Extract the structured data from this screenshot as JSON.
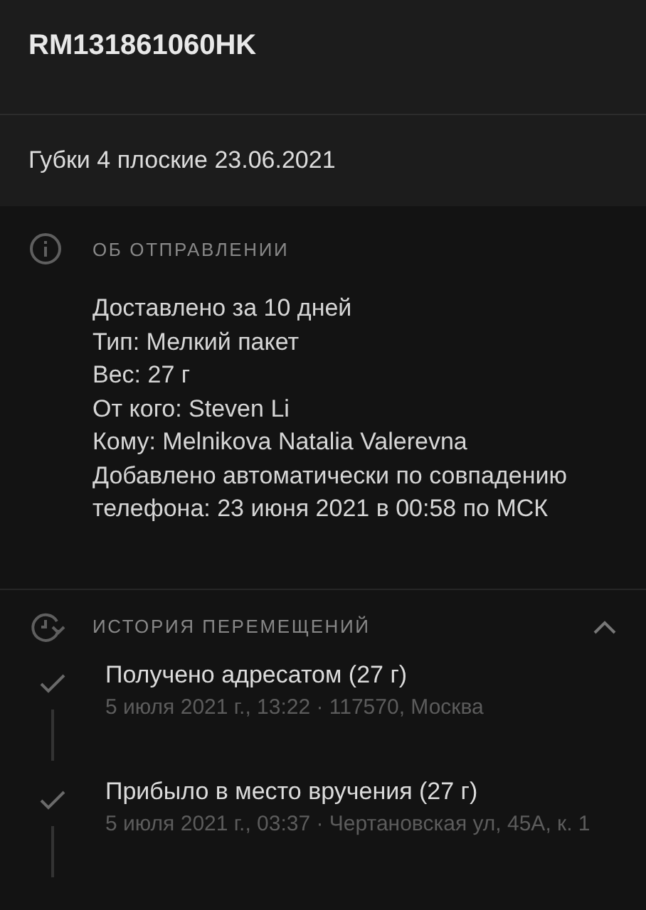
{
  "title": "RM131861060HK",
  "description": "Губки 4 плоские 23.06.2021",
  "about": {
    "heading": "ОБ ОТПРАВЛЕНИИ",
    "lines": [
      "Доставлено за 10 дней",
      "Тип: Мелкий пакет",
      "Вес: 27 г",
      "От кого: Steven Li",
      "Кому: Melnikova Natalia Valerevna",
      "Добавлено автоматически по совпадению телефона: 23 июня 2021 в 00:58 по МСК"
    ]
  },
  "history": {
    "heading": "ИСТОРИЯ ПЕРЕМЕЩЕНИЙ",
    "expanded": true,
    "events": [
      {
        "title": "Получено адресатом (27 г)",
        "details": "5 июля 2021 г., 13:22 · 117570, Москва",
        "done": true
      },
      {
        "title": "Прибыло в место вручения (27 г)",
        "details": "5 июля 2021 г., 03:37 · Чертановская ул, 45А, к. 1",
        "done": true
      }
    ]
  }
}
